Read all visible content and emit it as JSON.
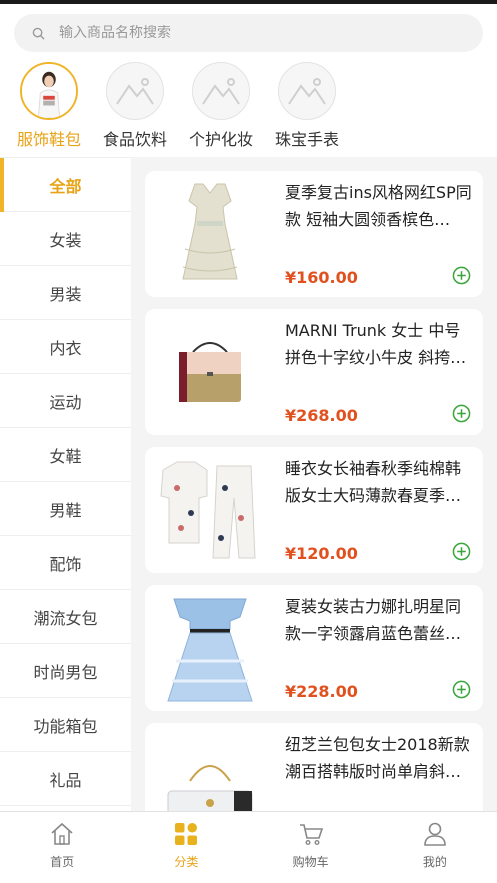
{
  "search": {
    "placeholder": "输入商品名称搜索"
  },
  "categories": [
    {
      "label": "服饰鞋包",
      "icon": "model-photo"
    },
    {
      "label": "食品饮料",
      "icon": "mountain-placeholder-icon"
    },
    {
      "label": "个护化妆",
      "icon": "mountain-placeholder-icon"
    },
    {
      "label": "珠宝手表",
      "icon": "mountain-placeholder-icon"
    }
  ],
  "sidebar": {
    "items": [
      {
        "label": "全部"
      },
      {
        "label": "女装"
      },
      {
        "label": "男装"
      },
      {
        "label": "内衣"
      },
      {
        "label": "运动"
      },
      {
        "label": "女鞋"
      },
      {
        "label": "男鞋"
      },
      {
        "label": "配饰"
      },
      {
        "label": "潮流女包"
      },
      {
        "label": "时尚男包"
      },
      {
        "label": "功能箱包"
      },
      {
        "label": "礼品"
      }
    ]
  },
  "products": [
    {
      "title": "夏季复古ins风格网红SP同款 短袖大圆领香槟色…",
      "price": "¥160.00"
    },
    {
      "title": "MARNI Trunk 女士 中号拼色十字纹小牛皮 斜挎…",
      "price": "¥268.00"
    },
    {
      "title": "睡衣女长袖春秋季纯棉韩版女士大码薄款春夏季…",
      "price": "¥120.00"
    },
    {
      "title": "夏装女装古力娜扎明星同款一字领露肩蓝色蕾丝…",
      "price": "¥228.00"
    },
    {
      "title": "纽芝兰包包女士2018新款潮百搭韩版时尚单肩斜…",
      "price": ""
    }
  ],
  "tabbar": {
    "items": [
      {
        "label": "首页",
        "icon": "home-icon"
      },
      {
        "label": "分类",
        "icon": "category-grid-icon"
      },
      {
        "label": "购物车",
        "icon": "cart-icon"
      },
      {
        "label": "我的",
        "icon": "user-icon"
      }
    ]
  },
  "colors": {
    "accent": "#f0b429",
    "price": "#e0511f",
    "add": "#3aa63a"
  }
}
